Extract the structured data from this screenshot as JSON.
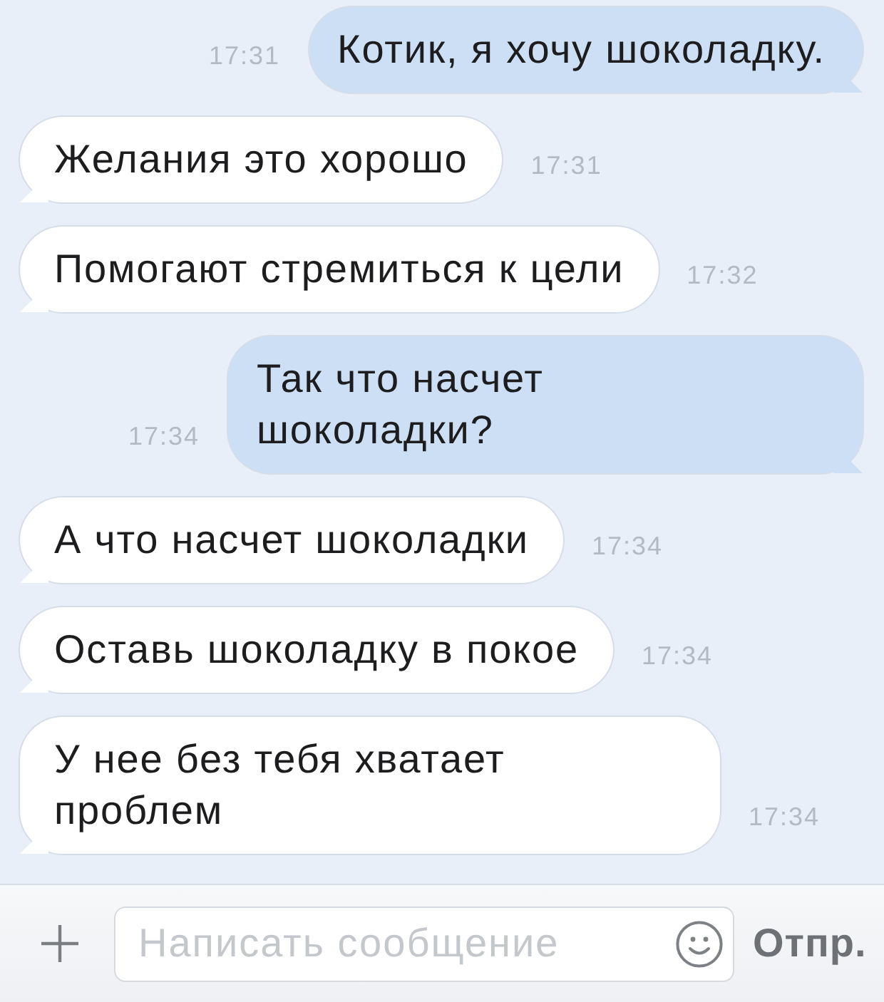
{
  "messages": [
    {
      "kind": "outgoing",
      "lines": [
        "Котик, я хочу шоколадку."
      ],
      "time": "17:31"
    },
    {
      "kind": "incoming",
      "lines": [
        "Желания это хорошо"
      ],
      "time": "17:31"
    },
    {
      "kind": "incoming",
      "lines": [
        "Помогают стремиться к цели"
      ],
      "time": "17:32"
    },
    {
      "kind": "outgoing",
      "lines": [
        "Так что насчет",
        "шоколадки?"
      ],
      "time": "17:34"
    },
    {
      "kind": "incoming",
      "lines": [
        "А что насчет шоколадки"
      ],
      "time": "17:34"
    },
    {
      "kind": "incoming",
      "lines": [
        "Оставь шоколадку в покое"
      ],
      "time": "17:34"
    },
    {
      "kind": "incoming",
      "lines": [
        "У нее без тебя хватает",
        "проблем"
      ],
      "time": "17:34"
    }
  ],
  "composer": {
    "placeholder": "Написать сообщение",
    "send_label": "Отпр."
  }
}
